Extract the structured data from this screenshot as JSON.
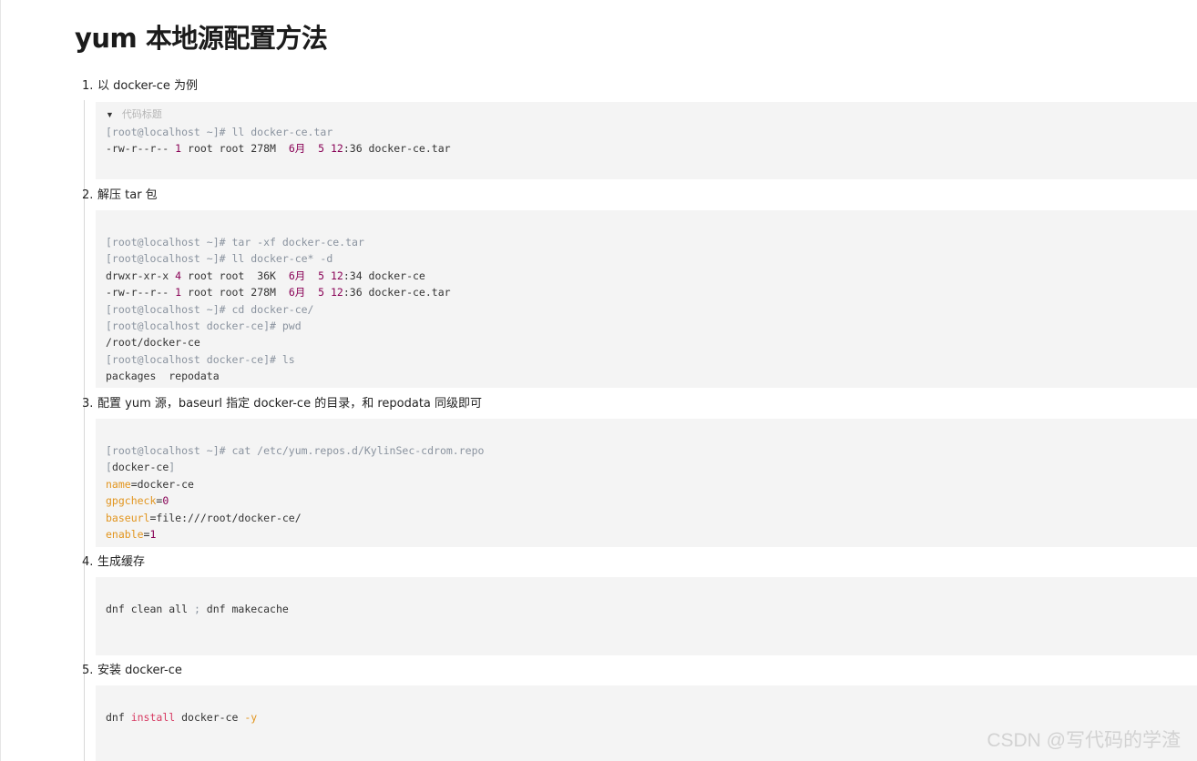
{
  "title": "yum 本地源配置方法",
  "steps": [
    {
      "num": "1.",
      "text": "以 docker-ce 为例",
      "caption": "代码标题",
      "code": [
        [
          {
            "t": "[root@localhost ~]",
            "c": "g"
          },
          {
            "t": "# ll docker-ce.tar",
            "c": "g"
          }
        ],
        [
          {
            "t": "-rw-r--r-- ",
            "c": ""
          },
          {
            "t": "1",
            "c": "n"
          },
          {
            "t": " root root 278M  ",
            "c": ""
          },
          {
            "t": "6月",
            "c": "n"
          },
          {
            "t": "  ",
            "c": ""
          },
          {
            "t": "5",
            "c": "n"
          },
          {
            "t": " ",
            "c": ""
          },
          {
            "t": "12",
            "c": "n"
          },
          {
            "t": ":36 docker-ce.tar",
            "c": ""
          }
        ]
      ]
    },
    {
      "num": "2.",
      "text": "解压 tar 包",
      "code": [
        [
          {
            "t": "[root@localhost ~]",
            "c": "g"
          },
          {
            "t": "# tar -xf docker-ce.tar",
            "c": "g"
          }
        ],
        [
          {
            "t": "[root@localhost ~]",
            "c": "g"
          },
          {
            "t": "# ll docker-ce* -d",
            "c": "g"
          }
        ],
        [
          {
            "t": "drwxr-xr-x ",
            "c": ""
          },
          {
            "t": "4",
            "c": "n"
          },
          {
            "t": " root root  36K  ",
            "c": ""
          },
          {
            "t": "6月",
            "c": "n"
          },
          {
            "t": "  ",
            "c": ""
          },
          {
            "t": "5",
            "c": "n"
          },
          {
            "t": " ",
            "c": ""
          },
          {
            "t": "12",
            "c": "n"
          },
          {
            "t": ":34 docker-ce",
            "c": ""
          }
        ],
        [
          {
            "t": "-rw-r--r-- ",
            "c": ""
          },
          {
            "t": "1",
            "c": "n"
          },
          {
            "t": " root root 278M  ",
            "c": ""
          },
          {
            "t": "6月",
            "c": "n"
          },
          {
            "t": "  ",
            "c": ""
          },
          {
            "t": "5",
            "c": "n"
          },
          {
            "t": " ",
            "c": ""
          },
          {
            "t": "12",
            "c": "n"
          },
          {
            "t": ":36 docker-ce.tar",
            "c": ""
          }
        ],
        [
          {
            "t": "[root@localhost ~]",
            "c": "g"
          },
          {
            "t": "# cd docker-ce/",
            "c": "g"
          }
        ],
        [
          {
            "t": "[root@localhost docker-ce]",
            "c": "g"
          },
          {
            "t": "# pwd",
            "c": "g"
          }
        ],
        [
          {
            "t": "/root/docker-ce",
            "c": ""
          }
        ],
        [
          {
            "t": "[root@localhost docker-ce]",
            "c": "g"
          },
          {
            "t": "# ls",
            "c": "g"
          }
        ],
        [
          {
            "t": "packages  repodata",
            "c": ""
          }
        ]
      ]
    },
    {
      "num": "3.",
      "text": "配置 yum 源，baseurl 指定 docker-ce 的目录，和 repodata 同级即可",
      "code": [
        [
          {
            "t": "[root@localhost ~]",
            "c": "g"
          },
          {
            "t": "# cat /etc/yum.repos.d/KylinSec-cdrom.repo",
            "c": "g"
          }
        ],
        [
          {
            "t": "[",
            "c": "g"
          },
          {
            "t": "docker-ce",
            "c": ""
          },
          {
            "t": "]",
            "c": "g"
          }
        ],
        [
          {
            "t": "name",
            "c": "o"
          },
          {
            "t": "=docker-ce",
            "c": ""
          }
        ],
        [
          {
            "t": "gpgcheck",
            "c": "o"
          },
          {
            "t": "=",
            "c": ""
          },
          {
            "t": "0",
            "c": "n"
          }
        ],
        [
          {
            "t": "baseurl",
            "c": "o"
          },
          {
            "t": "=file:///root/docker-ce/",
            "c": ""
          }
        ],
        [
          {
            "t": "enable",
            "c": "o"
          },
          {
            "t": "=",
            "c": ""
          },
          {
            "t": "1",
            "c": "n"
          }
        ]
      ]
    },
    {
      "num": "4.",
      "text": "生成缓存",
      "code": [
        [
          {
            "t": "dnf clean all ",
            "c": ""
          },
          {
            "t": ";",
            "c": "g"
          },
          {
            "t": " dnf makecache",
            "c": ""
          }
        ]
      ]
    },
    {
      "num": "5.",
      "text": "安装 docker-ce",
      "code": [
        [
          {
            "t": "dnf ",
            "c": ""
          },
          {
            "t": "install",
            "c": "r"
          },
          {
            "t": " docker-ce ",
            "c": ""
          },
          {
            "t": "-y",
            "c": "o"
          }
        ]
      ]
    }
  ],
  "watermark": "CSDN @写代码的学渣"
}
